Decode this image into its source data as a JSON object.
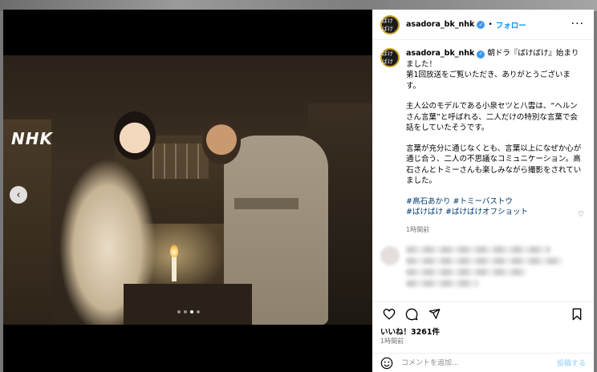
{
  "post": {
    "username": "asadora_bk_nhk",
    "follow_label": "フォロー",
    "separator": "•",
    "more_icon": "more-horizontal-icon",
    "avatar_text": "ばけばけ",
    "media": {
      "logo_text": "NHK",
      "carousel_dots": 4,
      "active_dot": 2
    },
    "caption": {
      "line1": "朝ドラ『ばけばけ』始まりました！",
      "line2": "第1回放送をご覧いただき、ありがとうございます。",
      "para2": "主人公のモデルである小泉セツと八雲は、“ヘルンさん言葉”と呼ばれる、二人だけの特別な言葉で会話をしていたそうです。",
      "para3": "言葉が充分に通じなくとも、言葉以上になぜか心が通じ合う、二人の不思議なコミュニケーション。高石さんとトミーさんも楽しみながら撮影をされていました。",
      "hashtags_line1": "#高石あかり #トミーバストウ",
      "hashtags_line2": "#ばけばけ #ばけばけオフショット",
      "time": "1時間前"
    },
    "likes_text": "いいね！3261件",
    "post_time": "1時間前",
    "comment_placeholder": "コメントを追加...",
    "post_button": "投稿する"
  },
  "colors": {
    "accent_blue": "#0095f6",
    "hashtag": "#00376b",
    "muted": "#737373"
  }
}
